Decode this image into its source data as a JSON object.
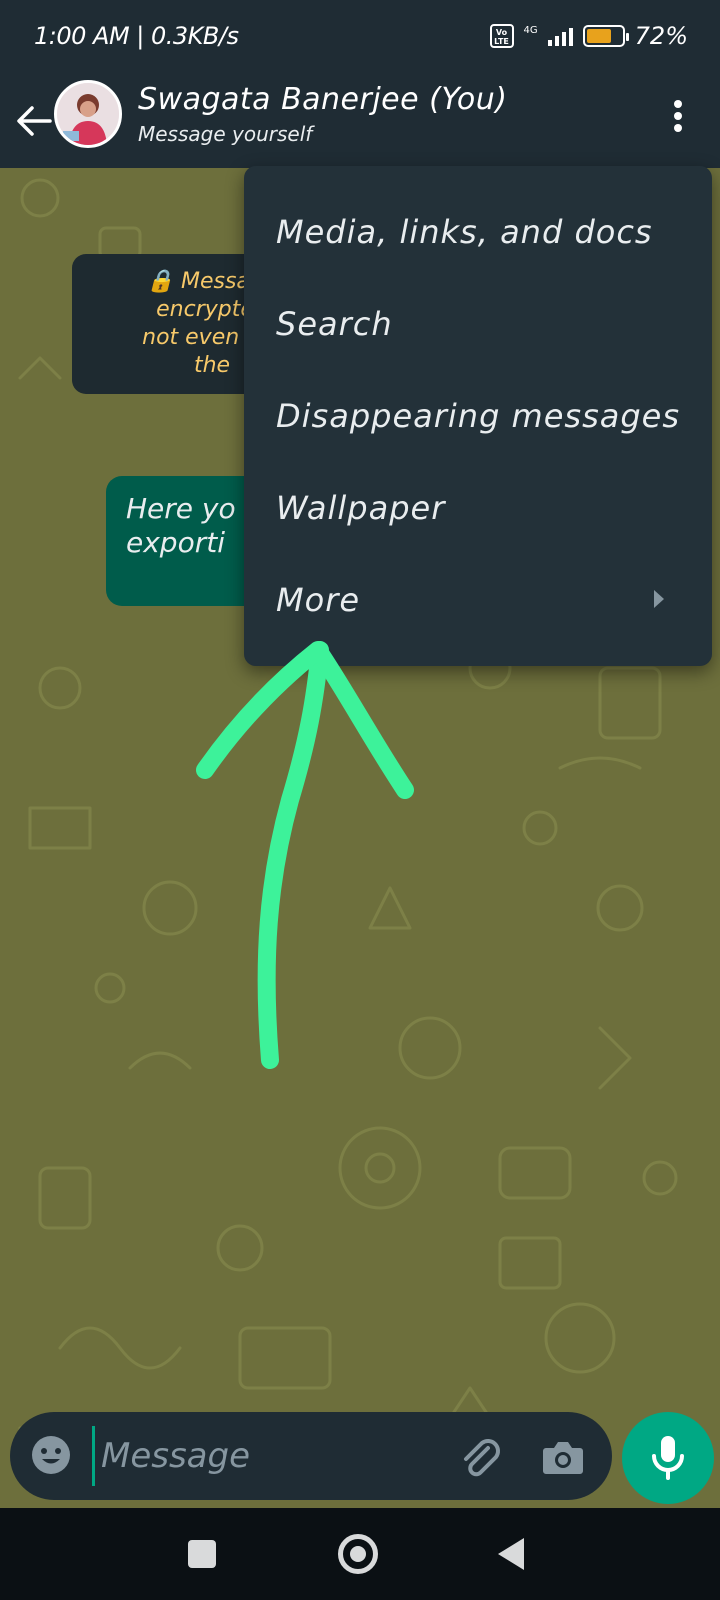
{
  "status_bar": {
    "time_speed": "1:00 AM | 0.3KB/s",
    "volte": "Vo LTE",
    "network": "4G",
    "battery_pct": "72%",
    "battery_level": 0.72
  },
  "header": {
    "contact_name": "Swagata Banerjee (You)",
    "subtitle": "Message yourself"
  },
  "chat": {
    "encryption_notice": [
      "🔒 Message",
      "encrypted",
      "not even Wh",
      "the"
    ],
    "message_bubble": [
      "Here yo",
      "exporti"
    ]
  },
  "menu": {
    "items": [
      {
        "label": "Media, links, and docs"
      },
      {
        "label": "Search"
      },
      {
        "label": "Disappearing messages"
      },
      {
        "label": "Wallpaper"
      },
      {
        "label": "More",
        "has_submenu": true
      }
    ]
  },
  "input": {
    "placeholder": "Message"
  },
  "colors": {
    "header_bg": "#1f2c34",
    "wallpaper": "#6d6f3c",
    "menu_bg": "#233139",
    "accent": "#00a884",
    "outgoing_bubble": "#005c4b",
    "annotation_arrow": "#3df29a",
    "notice_text": "#f7c96a"
  },
  "icons": {
    "back": "arrow-left-icon",
    "overflow": "more-vert-icon",
    "emoji": "emoji-icon",
    "attach": "paperclip-icon",
    "camera": "camera-icon",
    "mic": "mic-icon",
    "submenu": "chevron-right-icon"
  }
}
